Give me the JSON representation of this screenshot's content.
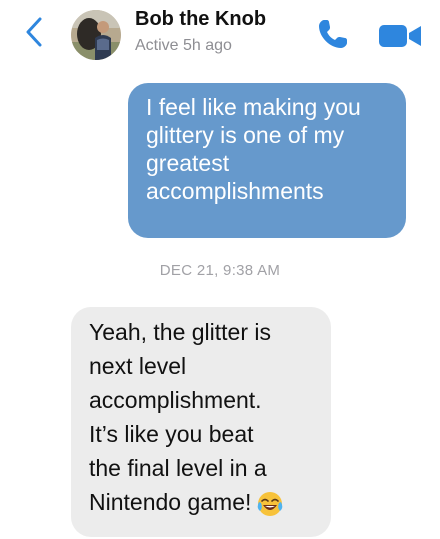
{
  "header": {
    "contact_name": "Bob the Knob",
    "status": "Active 5h ago",
    "accent_color": "#2e86de",
    "icons": [
      "chevron-left-icon",
      "avatar",
      "phone-icon",
      "video-camera-icon"
    ]
  },
  "messages": [
    {
      "direction": "outgoing",
      "bubble_color": "#6699cc",
      "lines": [
        "I feel like making you",
        "glittery is one of my",
        "greatest",
        "accomplishments"
      ]
    },
    {
      "direction": "incoming",
      "bubble_color": "#ececec",
      "lines": [
        "Yeah, the glitter is",
        "next level",
        "accomplishment.",
        "It’s like you beat",
        "the final level in a",
        "Nintendo game!"
      ],
      "emoji": "face-with-tears-of-joy"
    }
  ],
  "timestamp": "DEC 21, 9:38 AM"
}
